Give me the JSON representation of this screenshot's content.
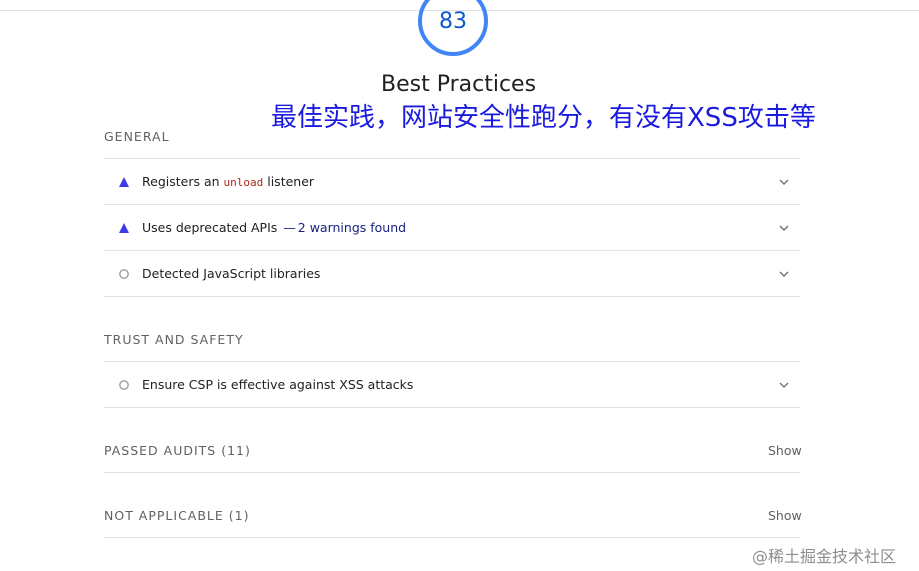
{
  "gauge": {
    "score": "83",
    "color": "#4285f4"
  },
  "category": {
    "title": "Best Practices"
  },
  "annotation": "最佳实践，网站安全性跑分，有没有XSS攻击等",
  "groups": {
    "general": {
      "heading": "GENERAL",
      "audits": [
        {
          "prefix": "Registers an ",
          "code": "unload",
          "suffix": " listener",
          "status": "warning-triangle",
          "color": "#3b3be8"
        },
        {
          "title": "Uses deprecated APIs",
          "display_value": "2 warnings found",
          "status": "warning-triangle",
          "color": "#3b3be8"
        },
        {
          "title": "Detected JavaScript libraries",
          "status": "informative-circle",
          "color": "#9e9e9e"
        }
      ]
    },
    "trust": {
      "heading": "TRUST AND SAFETY",
      "audits": [
        {
          "title": "Ensure CSP is effective against XSS attacks",
          "status": "informative-circle",
          "color": "#9e9e9e"
        }
      ]
    },
    "passed": {
      "heading": "PASSED AUDITS (11)",
      "toggle": "Show"
    },
    "not_applicable": {
      "heading": "NOT APPLICABLE (1)",
      "toggle": "Show"
    }
  },
  "watermark": "@稀土掘金技术社区"
}
